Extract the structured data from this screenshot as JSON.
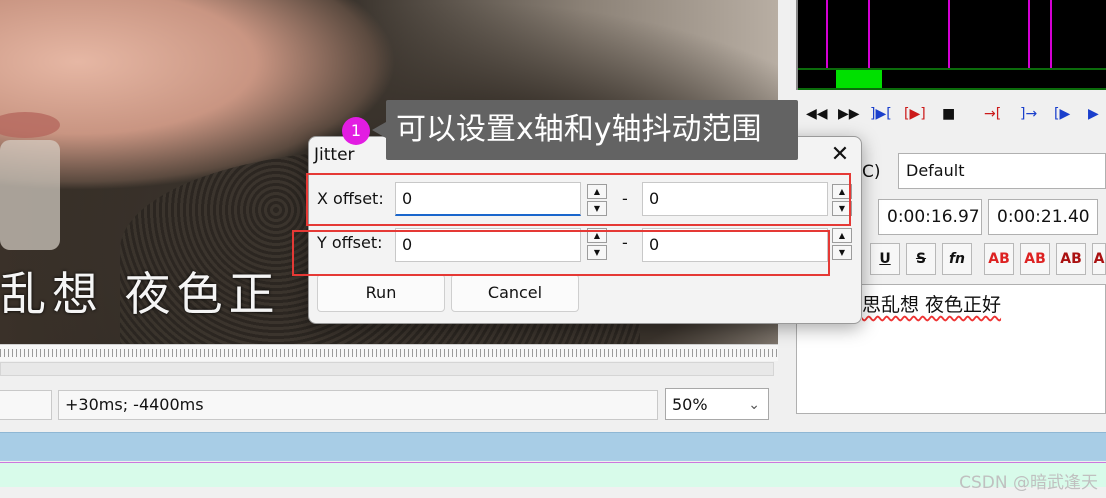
{
  "video": {
    "subtitle": "乱想  夜色正"
  },
  "status_bar": {
    "time_offset": "+30ms; -4400ms",
    "zoom": "50%"
  },
  "transport": {
    "icons": [
      "prev-line-icon",
      "next-line-icon",
      "play-selection-icon",
      "play-line-icon",
      "stop-icon",
      "mark-start-icon",
      "mark-end-icon",
      "go-to-icon",
      "commit-icon"
    ]
  },
  "edit_panel": {
    "actor_fragment": "C)",
    "style": "Default",
    "start_time": "0:00:16.97",
    "end_time": "0:00:21.40",
    "format_buttons": [
      "U",
      "S",
      "fn",
      "AB",
      "AB",
      "AB",
      "A"
    ],
    "text": "思乱想 夜色正好"
  },
  "jitter_dialog": {
    "title": "Jitter",
    "x_label": "X offset:",
    "x_from": "0",
    "x_to": "0",
    "y_label": "Y offset:",
    "y_from": "0",
    "y_to": "0",
    "separator": "-",
    "run_label": "Run",
    "cancel_label": "Cancel"
  },
  "annotation": {
    "step": "1",
    "text": "可以设置x轴和y轴抖动范围"
  },
  "watermark": "CSDN @暗武逢天",
  "colors": {
    "annotation_box": "#636363",
    "step_badge": "#e21ce2",
    "highlight_box": "#e53935",
    "audio_marker": "#d400d4",
    "audio_selection": "#00e000"
  }
}
